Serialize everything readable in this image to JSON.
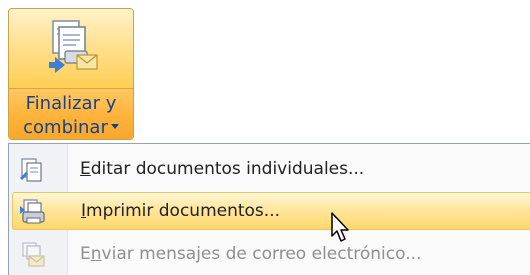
{
  "ribbon_button": {
    "label_line1": "Finalizar y",
    "label_line2": "combinar",
    "icon": "merge-documents-icon"
  },
  "menu": {
    "items": [
      {
        "accel": "E",
        "rest": "ditar documentos individuales...",
        "icon": "edit-documents-icon",
        "enabled": true,
        "hover": false
      },
      {
        "accel": "I",
        "rest": "mprimir documentos...",
        "icon": "print-documents-icon",
        "enabled": true,
        "hover": true
      },
      {
        "accel_pre": "E",
        "accel": "n",
        "rest": "viar mensajes de correo electrónico...",
        "icon": "send-email-icon",
        "enabled": false,
        "hover": false
      }
    ]
  },
  "colors": {
    "ribbon_label": "#15428b",
    "highlight": "#ffe59a",
    "disabled_text": "#8f8f8f"
  }
}
